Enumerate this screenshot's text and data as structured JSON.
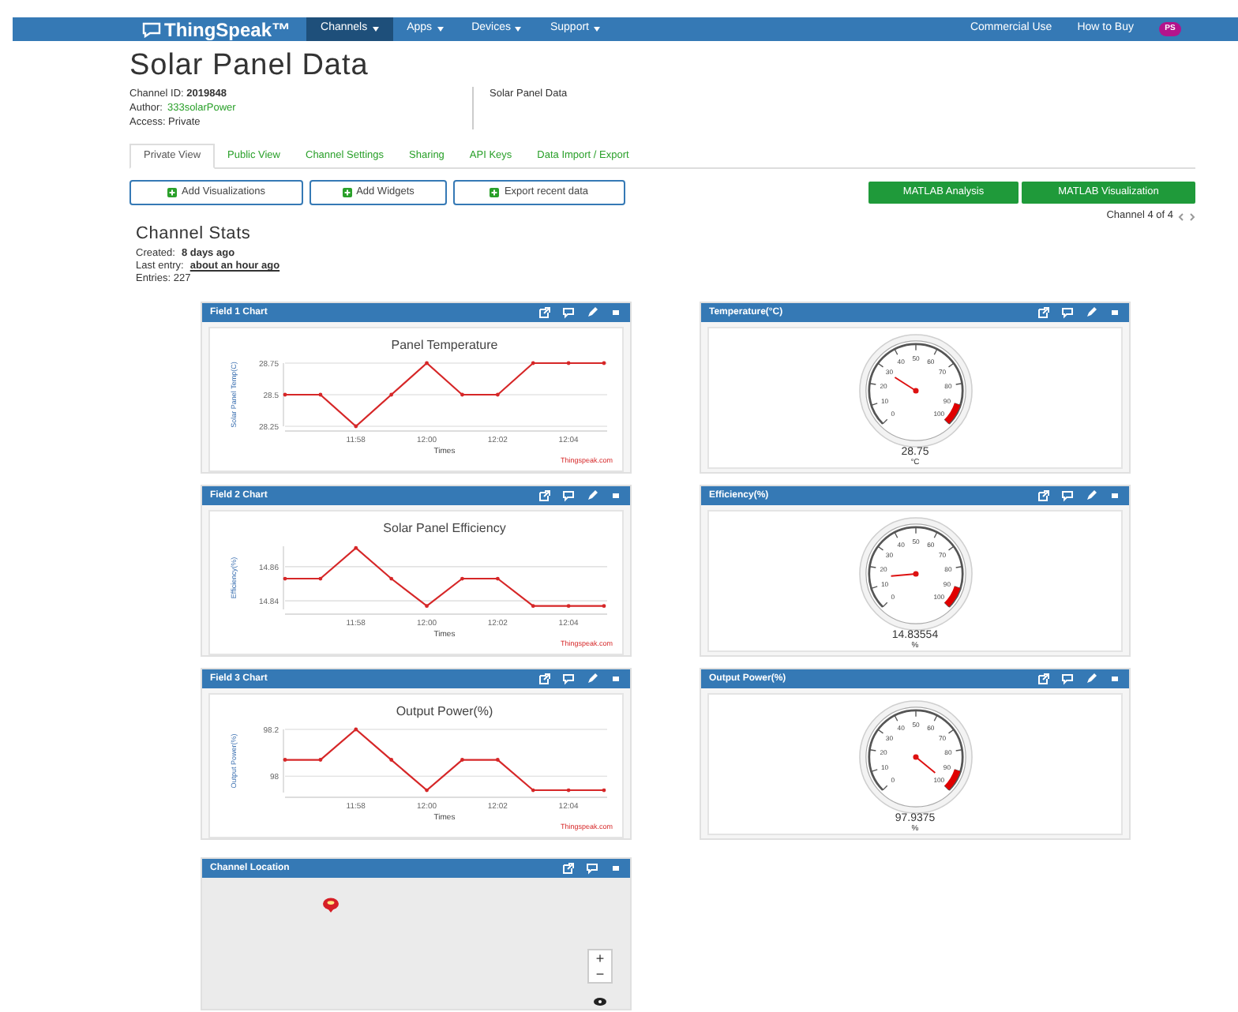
{
  "nav": {
    "logo": "ThingSpeak™",
    "items": [
      {
        "label": "Channels",
        "selected": true
      },
      {
        "label": "Apps",
        "selected": false
      },
      {
        "label": "Devices",
        "selected": false
      },
      {
        "label": "Support",
        "selected": false
      }
    ],
    "right_links": [
      "Commercial Use",
      "How to Buy"
    ],
    "avatar": "PS"
  },
  "title": "Solar Panel Data",
  "channel_info": {
    "id_label": "Channel ID:",
    "id": "2019848",
    "author_label": "Author:",
    "author": "333solarPower",
    "access": "Access: Private",
    "description": "Solar Panel Data"
  },
  "tabs": [
    {
      "label": "Private View",
      "selected": true
    },
    {
      "label": "Public View",
      "selected": false
    },
    {
      "label": "Channel Settings",
      "selected": false
    },
    {
      "label": "Sharing",
      "selected": false
    },
    {
      "label": "API Keys",
      "selected": false
    },
    {
      "label": "Data Import / Export",
      "selected": false
    }
  ],
  "action_buttons": [
    "Add Visualizations",
    "Add Widgets",
    "Export recent data"
  ],
  "matlab_buttons": [
    "MATLAB Analysis",
    "MATLAB Visualization"
  ],
  "channel_nav": "Channel 4 of 4",
  "stats": {
    "title": "Channel Stats",
    "created_label": "Created:",
    "created": "8 days ago",
    "last_entry_label": "Last entry:",
    "last_entry": "about an hour ago",
    "entries": "Entries: 227"
  },
  "panels": [
    {
      "kind": "line_chart",
      "title": "Field 1 Chart",
      "credit": "Thingspeak.com",
      "chart_data": {
        "type": "line",
        "title": "Panel Temperature",
        "xlabel": "Times",
        "ylabel": "Solar Panel Temp(C)",
        "categories": [
          null,
          null,
          "11:58",
          null,
          "12:00",
          null,
          "12:02",
          null,
          "12:04",
          null
        ],
        "values": [
          28.5,
          28.5,
          28.25,
          28.5,
          28.75,
          28.5,
          28.5,
          28.75,
          28.75,
          28.75
        ],
        "ylim": [
          28.25,
          28.75
        ],
        "yticks": [
          28.25,
          28.5,
          28.75
        ]
      }
    },
    {
      "kind": "gauge",
      "title": "Temperature(°C)",
      "value": "28.75",
      "unit": "°C",
      "ticks": [
        "0",
        "10",
        "20",
        "30",
        "40",
        "50",
        "60",
        "70",
        "80",
        "90",
        "100"
      ]
    },
    {
      "kind": "line_chart",
      "title": "Field 2 Chart",
      "credit": "Thingspeak.com",
      "chart_data": {
        "type": "line",
        "title": "Solar Panel Efficiency",
        "xlabel": "Times",
        "ylabel": "Efficiency(%)",
        "categories": [
          null,
          null,
          "11:58",
          null,
          "12:00",
          null,
          "12:02",
          null,
          "12:04",
          null
        ],
        "values": [
          14.853,
          14.853,
          14.871,
          14.853,
          14.837,
          14.853,
          14.853,
          14.837,
          14.837,
          14.837
        ],
        "ylim": [
          14.835,
          14.872
        ],
        "yticks": [
          14.84,
          14.86
        ]
      }
    },
    {
      "kind": "gauge",
      "title": "Efficiency(%)",
      "value": "14.83554",
      "unit": "%",
      "ticks": [
        "0",
        "10",
        "20",
        "30",
        "40",
        "50",
        "60",
        "70",
        "80",
        "90",
        "100"
      ]
    },
    {
      "kind": "line_chart",
      "title": "Field 3 Chart",
      "credit": "Thingspeak.com",
      "chart_data": {
        "type": "line",
        "title": "Output Power(%)",
        "xlabel": "Times",
        "ylabel": "Output Power(%)",
        "categories": [
          null,
          null,
          "11:58",
          null,
          "12:00",
          null,
          "12:02",
          null,
          "12:04",
          null
        ],
        "values": [
          98.07,
          98.07,
          98.2,
          98.07,
          97.94,
          98.07,
          98.07,
          97.94,
          97.94,
          97.94
        ],
        "ylim": [
          97.93,
          98.2
        ],
        "yticks": [
          98,
          98.2
        ]
      }
    },
    {
      "kind": "gauge",
      "title": "Output Power(%)",
      "value": "97.9375",
      "unit": "%",
      "ticks": [
        "0",
        "10",
        "20",
        "30",
        "40",
        "50",
        "60",
        "70",
        "80",
        "90",
        "100"
      ]
    },
    {
      "kind": "map",
      "title": "Channel Location",
      "map_controls": [
        "+",
        "−"
      ]
    }
  ]
}
